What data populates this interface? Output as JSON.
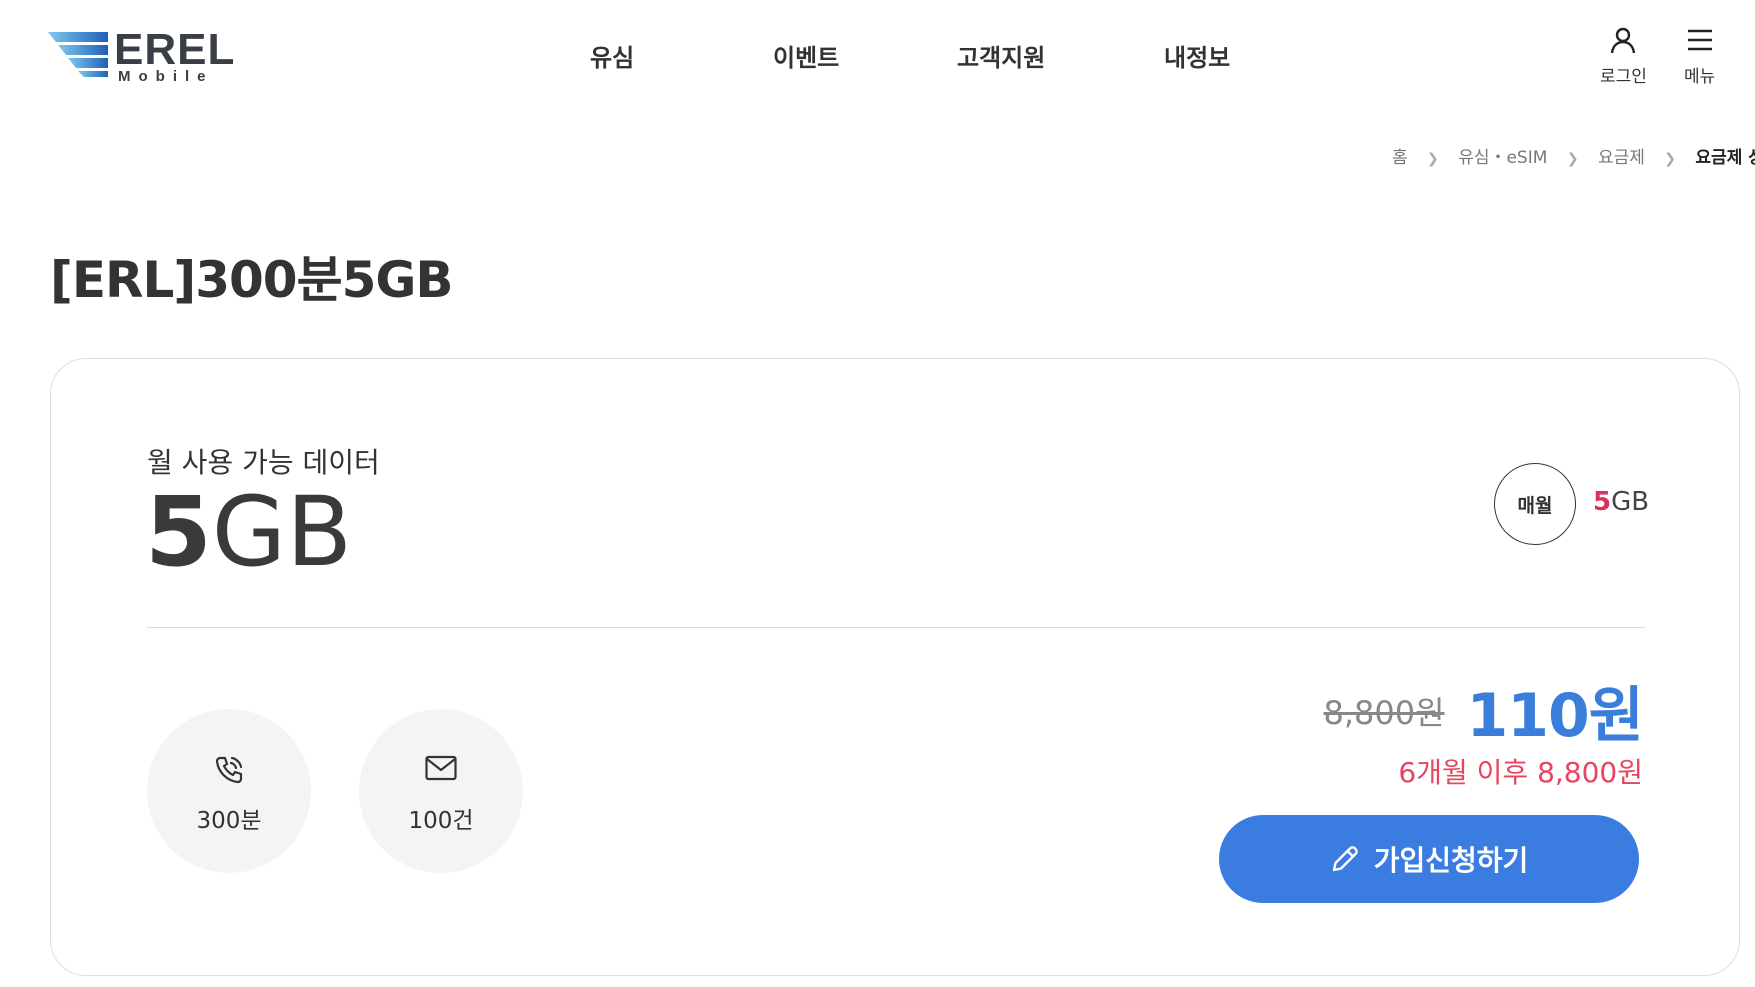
{
  "header": {
    "logo": {
      "text": "EREL",
      "sub": "Mobile"
    },
    "nav": [
      {
        "label": "유심"
      },
      {
        "label": "이벤트"
      },
      {
        "label": "고객지원"
      },
      {
        "label": "내정보"
      }
    ],
    "utilities": {
      "login_label": "로그인",
      "menu_label": "메뉴"
    }
  },
  "breadcrumb": [
    {
      "label": "홈"
    },
    {
      "label": "유심・eSIM"
    },
    {
      "label": "요금제"
    },
    {
      "label": "요금제 상세"
    }
  ],
  "page_title": "[ERL]300분5GB",
  "plan": {
    "data_label": "월 사용 가능 데이터",
    "data_amount_num": "5",
    "data_amount_unit": "GB",
    "monthly_badge": "매월",
    "monthly_data_num": "5",
    "monthly_data_unit": "GB",
    "features": [
      {
        "icon": "phone-icon",
        "label": "300분"
      },
      {
        "icon": "mail-icon",
        "label": "100건"
      }
    ],
    "original_price": "8,800원",
    "discount_price": "110원",
    "price_after": "6개월 이후 8,800원",
    "cta_label": "가입신청하기"
  },
  "colors": {
    "accent_blue": "#3b7ce0",
    "price_blue": "#3a7ddb",
    "highlight_red": "#e8445e",
    "data_pink": "#d6345a"
  }
}
